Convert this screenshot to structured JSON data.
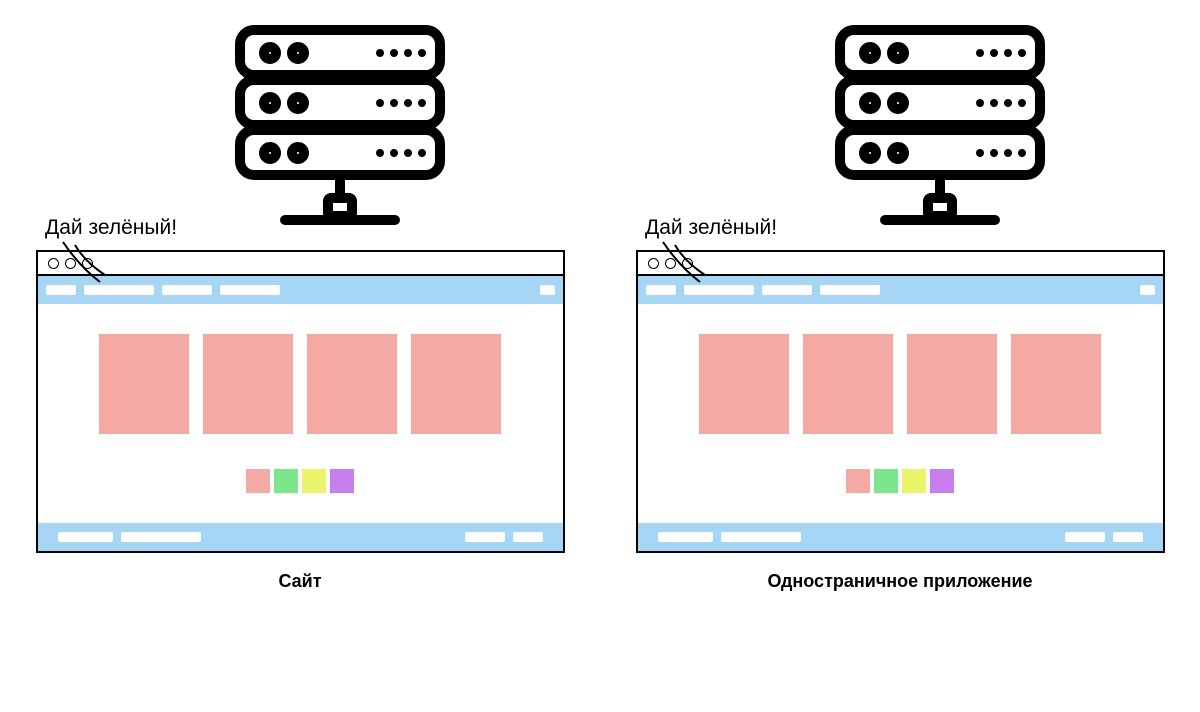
{
  "panels": [
    {
      "speech": "Дай зелёный!",
      "caption": "Сайт"
    },
    {
      "speech": "Дай зелёный!",
      "caption": "Одностраничное приложение"
    }
  ],
  "colors": {
    "toolbar": "#a5d6f5",
    "card": "#f5a9a3",
    "swatches": [
      "#f5a9a3",
      "#7be68a",
      "#eaf56a",
      "#c77ff0"
    ]
  }
}
